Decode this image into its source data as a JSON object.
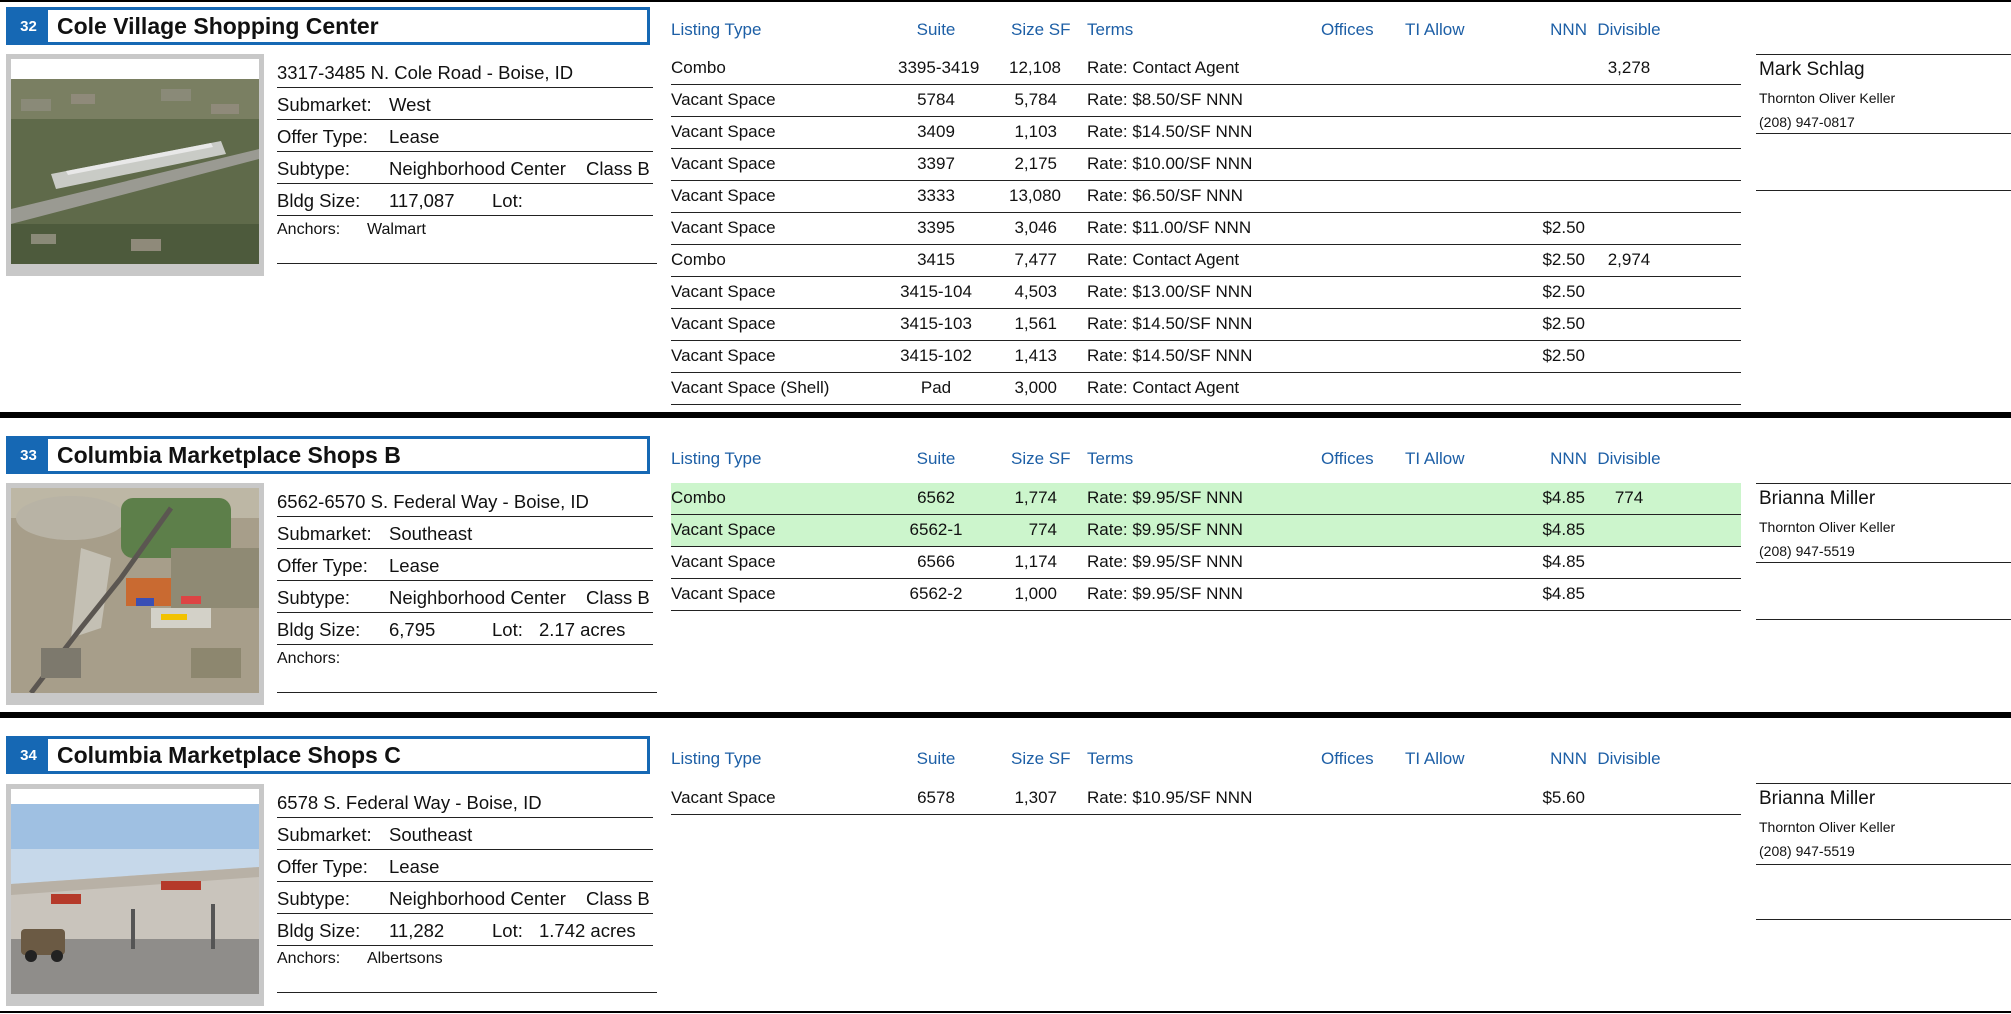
{
  "columns": {
    "listing_type": "Listing Type",
    "suite": "Suite",
    "size_sf": "Size SF",
    "terms": "Terms",
    "offices": "Offices",
    "ti_allow": "TI Allow",
    "nnn": "NNN",
    "divisible": "Divisible"
  },
  "labels": {
    "submarket": "Submarket:",
    "offer_type": "Offer Type:",
    "subtype": "Subtype:",
    "bldg_size": "Bldg Size:",
    "lot": "Lot:",
    "anchors": "Anchors:"
  },
  "colors": {
    "brand_blue": "#1668b4",
    "highlight_green": "#ccf5cc"
  },
  "properties": [
    {
      "number": "32",
      "name": "Cole Village Shopping Center",
      "address": "3317-3485 N. Cole Road - Boise, ID",
      "submarket": "West",
      "offer_type": "Lease",
      "subtype": "Neighborhood Center",
      "class": "Class B",
      "bldg_size": "117,087",
      "lot": "",
      "anchors": "Walmart",
      "contact": {
        "name": "Mark Schlag",
        "firm": "Thornton Oliver Keller",
        "phone": "(208) 947-0817"
      },
      "listings": [
        {
          "type": "Combo",
          "suite": "3395-3419",
          "size": "12,108",
          "terms": "Rate:  Contact Agent",
          "nnn": "",
          "divisible": "3,278",
          "highlight": false
        },
        {
          "type": "Vacant Space",
          "suite": "5784",
          "size": "5,784",
          "terms": "Rate:  $8.50/SF NNN",
          "nnn": "",
          "divisible": "",
          "highlight": false
        },
        {
          "type": "Vacant Space",
          "suite": "3409",
          "size": "1,103",
          "terms": "Rate:  $14.50/SF NNN",
          "nnn": "",
          "divisible": "",
          "highlight": false
        },
        {
          "type": "Vacant Space",
          "suite": "3397",
          "size": "2,175",
          "terms": "Rate:  $10.00/SF NNN",
          "nnn": "",
          "divisible": "",
          "highlight": false
        },
        {
          "type": "Vacant Space",
          "suite": "3333",
          "size": "13,080",
          "terms": "Rate:  $6.50/SF NNN",
          "nnn": "",
          "divisible": "",
          "highlight": false
        },
        {
          "type": "Vacant Space",
          "suite": "3395",
          "size": "3,046",
          "terms": "Rate:  $11.00/SF NNN",
          "nnn": "$2.50",
          "divisible": "",
          "highlight": false
        },
        {
          "type": "Combo",
          "suite": "3415",
          "size": "7,477",
          "terms": "Rate:  Contact Agent",
          "nnn": "$2.50",
          "divisible": "2,974",
          "highlight": false
        },
        {
          "type": "Vacant Space",
          "suite": "3415-104",
          "size": "4,503",
          "terms": "Rate:  $13.00/SF NNN",
          "nnn": "$2.50",
          "divisible": "",
          "highlight": false
        },
        {
          "type": "Vacant Space",
          "suite": "3415-103",
          "size": "1,561",
          "terms": "Rate:  $14.50/SF NNN",
          "nnn": "$2.50",
          "divisible": "",
          "highlight": false
        },
        {
          "type": "Vacant Space",
          "suite": "3415-102",
          "size": "1,413",
          "terms": "Rate:  $14.50/SF NNN",
          "nnn": "$2.50",
          "divisible": "",
          "highlight": false
        },
        {
          "type": "Vacant Space (Shell)",
          "suite": "Pad",
          "size": "3,000",
          "terms": "Rate:  Contact Agent",
          "nnn": "",
          "divisible": "",
          "highlight": false
        }
      ]
    },
    {
      "number": "33",
      "name": "Columbia Marketplace Shops B",
      "address": "6562-6570 S. Federal Way - Boise, ID",
      "submarket": "Southeast",
      "offer_type": "Lease",
      "subtype": "Neighborhood Center",
      "class": "Class B",
      "bldg_size": "6,795",
      "lot": "2.17 acres",
      "anchors": "",
      "contact": {
        "name": "Brianna Miller",
        "firm": "Thornton Oliver Keller",
        "phone": "(208) 947-5519"
      },
      "listings": [
        {
          "type": "Combo",
          "suite": "6562",
          "size": "1,774",
          "terms": "Rate:  $9.95/SF NNN",
          "nnn": "$4.85",
          "divisible": "774",
          "highlight": true
        },
        {
          "type": "Vacant Space",
          "suite": "6562-1",
          "size": "774",
          "terms": "Rate:  $9.95/SF NNN",
          "nnn": "$4.85",
          "divisible": "",
          "highlight": true
        },
        {
          "type": "Vacant Space",
          "suite": "6566",
          "size": "1,174",
          "terms": "Rate:  $9.95/SF NNN",
          "nnn": "$4.85",
          "divisible": "",
          "highlight": false
        },
        {
          "type": "Vacant Space",
          "suite": "6562-2",
          "size": "1,000",
          "terms": "Rate:  $9.95/SF NNN",
          "nnn": "$4.85",
          "divisible": "",
          "highlight": false
        }
      ]
    },
    {
      "number": "34",
      "name": "Columbia Marketplace Shops C",
      "address": "6578 S. Federal Way - Boise, ID",
      "submarket": "Southeast",
      "offer_type": "Lease",
      "subtype": "Neighborhood Center",
      "class": "Class B",
      "bldg_size": "11,282",
      "lot": "1.742 acres",
      "anchors": "Albertsons",
      "contact": {
        "name": "Brianna Miller",
        "firm": "Thornton Oliver Keller",
        "phone": "(208) 947-5519"
      },
      "listings": [
        {
          "type": "Vacant Space",
          "suite": "6578",
          "size": "1,307",
          "terms": "Rate:  $10.95/SF NNN",
          "nnn": "$5.60",
          "divisible": "",
          "highlight": false
        }
      ]
    }
  ]
}
